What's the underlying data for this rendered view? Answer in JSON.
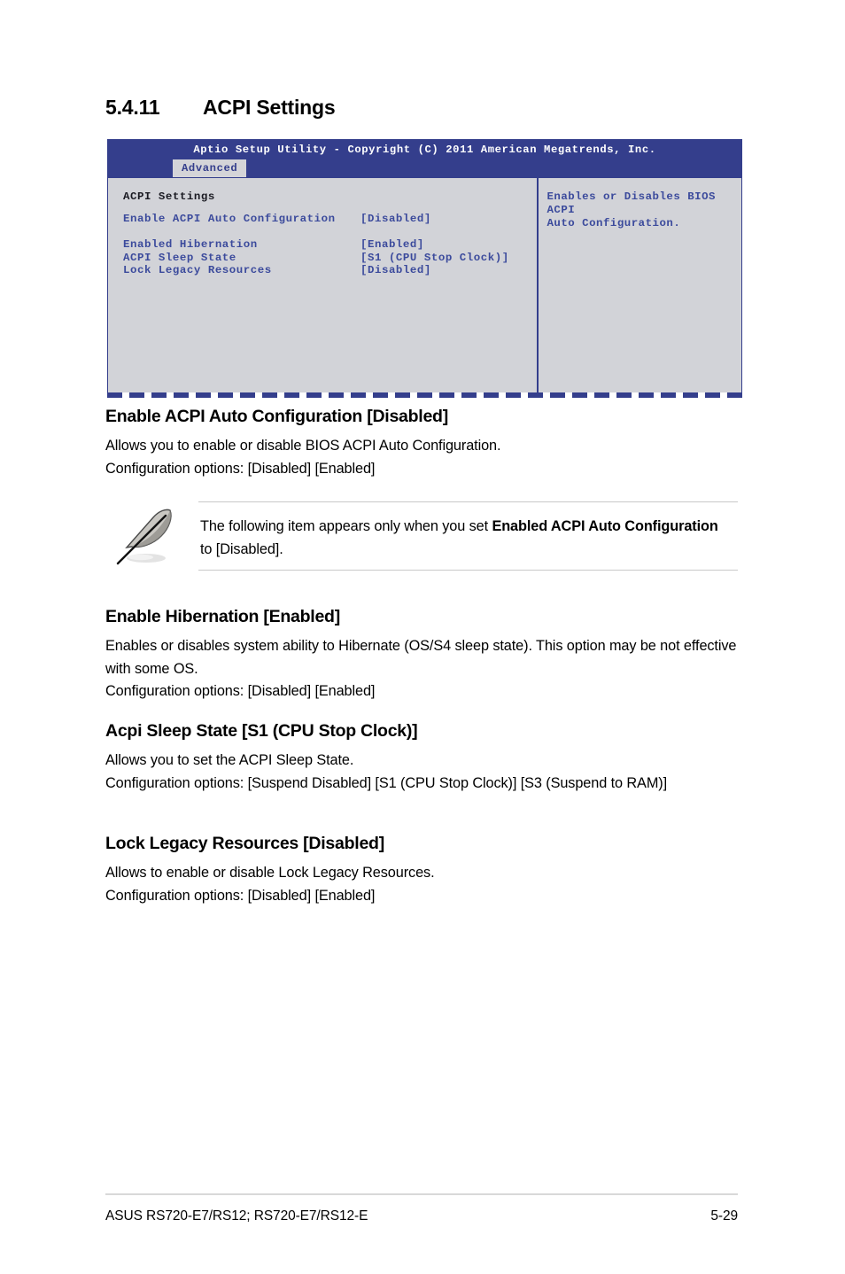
{
  "heading": {
    "number": "5.4.11",
    "title": "ACPI Settings"
  },
  "bios": {
    "title_bar": "Aptio Setup Utility - Copyright (C) 2011 American Megatrends, Inc.",
    "active_tab": "Advanced",
    "section_title": "ACPI Settings",
    "rows": [
      {
        "label": "Enable ACPI Auto Configuration",
        "value": "[Disabled]"
      },
      {
        "label": "Enabled Hibernation",
        "value": "[Enabled]"
      },
      {
        "label": "ACPI Sleep State",
        "value": "[S1 (CPU Stop Clock)]"
      },
      {
        "label": "Lock Legacy Resources",
        "value": "[Disabled]"
      }
    ],
    "help_text": "Enables or Disables BIOS ACPI\nAuto Configuration.",
    "colors": {
      "header_blue": "#343e8c",
      "panel_gray": "#d2d3d8",
      "tab_gray": "#d4d4d8",
      "item_blue": "#3b4a9c"
    }
  },
  "sections": [
    {
      "heading": "Enable ACPI Auto Configuration [Disabled]",
      "line1": "Allows you to enable or disable BIOS ACPI Auto Configuration.",
      "line2": "Configuration options: [Disabled] [Enabled]"
    },
    {
      "heading": "Enable Hibernation [Enabled]",
      "line1": "Enables or disables system ability to Hibernate (OS/S4 sleep state). This option may be not effective with some OS.",
      "line2": "Configuration options: [Disabled] [Enabled]"
    },
    {
      "heading": "Acpi Sleep State [S1 (CPU Stop Clock)]",
      "line1": "Allows you to set the ACPI Sleep State.",
      "line2": "Configuration options: [Suspend Disabled] [S1 (CPU Stop Clock)] [S3 (Suspend to RAM)]"
    },
    {
      "heading": "Lock Legacy Resources [Disabled]",
      "line1": "Allows to enable or disable Lock Legacy Resources.",
      "line2": "Configuration options: [Disabled] [Enabled]"
    }
  ],
  "note": {
    "icon": "quill-pen-icon",
    "text_before": "The following item appears only when you set ",
    "text_bold": "Enabled ACPI Auto Configuration",
    "text_after": " to [Disabled]."
  },
  "footer": {
    "left": "ASUS RS720-E7/RS12; RS720-E7/RS12-E",
    "right": "5-29"
  }
}
